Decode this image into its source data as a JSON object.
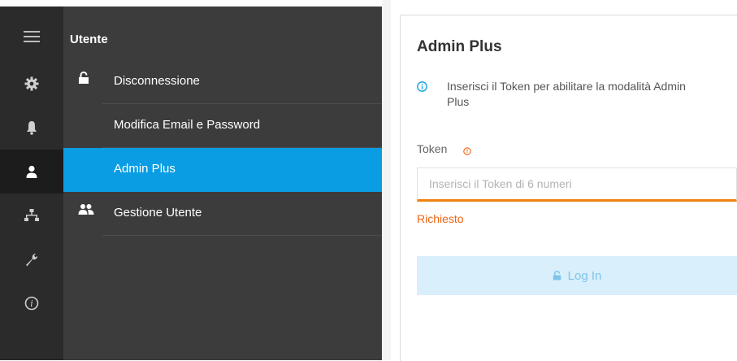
{
  "sidebar": {
    "icons": [
      {
        "name": "hamburger-menu-icon"
      },
      {
        "name": "gear-icon"
      },
      {
        "name": "bell-icon"
      },
      {
        "name": "user-icon",
        "active": true
      },
      {
        "name": "network-icon"
      },
      {
        "name": "wrench-icon"
      },
      {
        "name": "info-icon"
      }
    ]
  },
  "menu": {
    "title": "Utente",
    "items": [
      {
        "label": "Disconnessione",
        "icon": "lock-icon"
      },
      {
        "label": "Modifica Email e Password",
        "icon": ""
      },
      {
        "label": "Admin Plus",
        "icon": "",
        "active": true
      },
      {
        "label": "Gestione Utente",
        "icon": "users-icon"
      }
    ]
  },
  "panel": {
    "title": "Admin Plus",
    "info": "Inserisci il Token per abilitare la modalità Admin Plus",
    "token_label": "Token",
    "token_placeholder": "Inserisci il Token di 6 numeri",
    "token_value": "",
    "error": "Richiesto",
    "login_label": "Log In"
  },
  "colors": {
    "accent": "#0a9de3",
    "error": "#f0620f",
    "login_disabled_bg": "#d9effb"
  }
}
